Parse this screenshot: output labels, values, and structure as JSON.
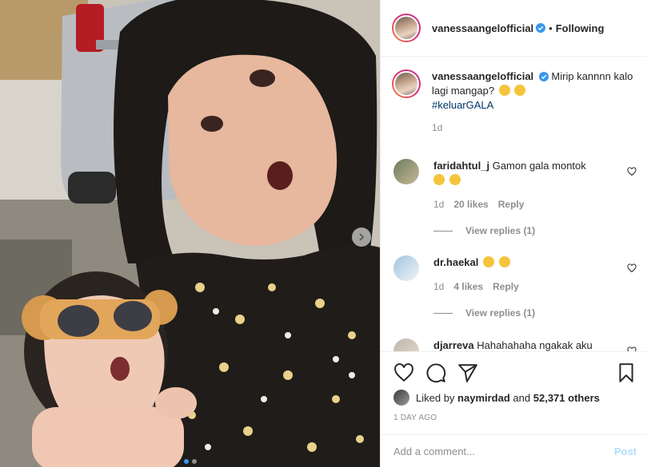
{
  "post": {
    "username": "vanessaangelofficial",
    "follow_label": "Following",
    "separator": "•",
    "caption_text": "Mirip kannnn kalo lagi mangap?",
    "hashtag": "#keluarGALA",
    "caption_age": "1d",
    "likes_by_user": "naymirdad",
    "likes_others": "52,371 others",
    "likes_prefix": "Liked by",
    "likes_and": "and",
    "time_ago": "1 DAY AGO",
    "comment_placeholder": "Add a comment...",
    "post_label": "Post"
  },
  "comments": [
    {
      "username": "faridahtul_j",
      "text": "Gamon gala montok",
      "age": "1d",
      "likes": "20 likes",
      "reply_label": "Reply",
      "view_replies": "View replies (1)"
    },
    {
      "username": "dr.haekal",
      "text": "",
      "age": "1d",
      "likes": "4 likes",
      "reply_label": "Reply",
      "view_replies": "View replies (1)"
    },
    {
      "username": "djarreva",
      "text": "Hahahahaha ngakak aku"
    }
  ],
  "icons": {
    "verified": "verified-badge-icon",
    "heart": "heart-icon",
    "comment": "comment-icon",
    "share": "share-icon",
    "save": "bookmark-icon",
    "next": "chevron-right-icon"
  },
  "colors": {
    "verified": "#3897f0",
    "link": "#00376b",
    "muted": "#8e8e8e",
    "post_disabled": "#b2dffc"
  }
}
